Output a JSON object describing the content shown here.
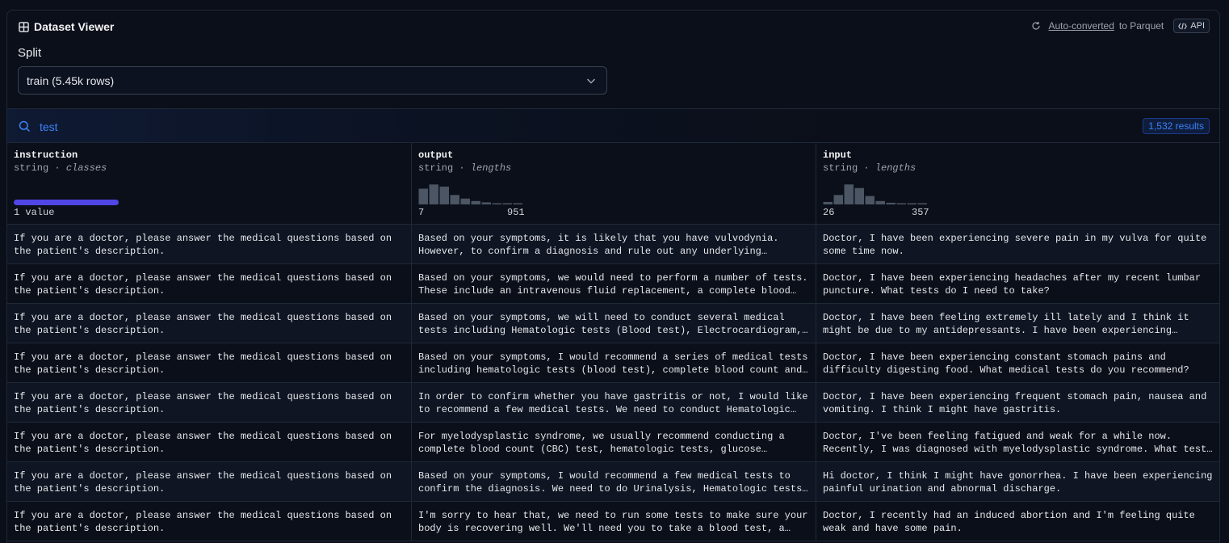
{
  "header": {
    "title": "Dataset Viewer",
    "auto_converted": "Auto-converted",
    "to_parquet": "to Parquet",
    "api": "API"
  },
  "split": {
    "label": "Split",
    "selected": "train (5.45k rows)"
  },
  "search": {
    "value": "test",
    "results": "1,532 results"
  },
  "columns": [
    {
      "name": "instruction",
      "type": "string",
      "kind": "classes",
      "summary": "1 value"
    },
    {
      "name": "output",
      "type": "string",
      "kind": "lengths",
      "min": "7",
      "max": "951",
      "histogram": [
        0.75,
        0.95,
        0.85,
        0.45,
        0.28,
        0.16,
        0.1,
        0.05,
        0.03,
        0.02
      ]
    },
    {
      "name": "input",
      "type": "string",
      "kind": "lengths",
      "min": "26",
      "max": "357",
      "histogram": [
        0.12,
        0.45,
        0.95,
        0.78,
        0.4,
        0.16,
        0.08,
        0.04,
        0.02,
        0.02
      ]
    }
  ],
  "rows": [
    {
      "instruction": "If you are a doctor, please answer the medical questions based on the patient's description.",
      "output": "Based on your symptoms, it is likely that you have vulvodynia. However, to confirm a diagnosis and rule out any underlying conditions, we need to run some tests.",
      "input": "Doctor, I have been experiencing severe pain in my vulva for quite some time now."
    },
    {
      "instruction": "If you are a doctor, please answer the medical questions based on the patient's description.",
      "output": "Based on your symptoms, we would need to perform a number of tests. These include an intravenous fluid replacement, a complete blood count and more.",
      "input": "Doctor, I have been experiencing headaches after my recent lumbar puncture. What tests do I need to take?"
    },
    {
      "instruction": "If you are a doctor, please answer the medical questions based on the patient's description.",
      "output": "Based on your symptoms, we will need to conduct several medical tests including Hematologic tests (Blood test), Electrocardiogram, and more.",
      "input": "Doctor, I have been feeling extremely ill lately and I think it might be due to my antidepressants. I have been experiencing nausea."
    },
    {
      "instruction": "If you are a doctor, please answer the medical questions based on the patient's description.",
      "output": "Based on your symptoms, I would recommend a series of medical tests including hematologic tests (blood test), complete blood count and others.",
      "input": "Doctor, I have been experiencing constant stomach pains and difficulty digesting food. What medical tests do you recommend?"
    },
    {
      "instruction": "If you are a doctor, please answer the medical questions based on the patient's description.",
      "output": "In order to confirm whether you have gastritis or not, I would like to recommend a few medical tests. We need to conduct Hematologic tests.",
      "input": "Doctor, I have been experiencing frequent stomach pain, nausea and vomiting. I think I might have gastritis."
    },
    {
      "instruction": "If you are a doctor, please answer the medical questions based on the patient's description.",
      "output": "For myelodysplastic syndrome, we usually recommend conducting a complete blood count (CBC) test, hematologic tests, glucose measurement and others.",
      "input": "Doctor, I've been feeling fatigued and weak for a while now. Recently, I was diagnosed with myelodysplastic syndrome. What tests do I need?"
    },
    {
      "instruction": "If you are a doctor, please answer the medical questions based on the patient's description.",
      "output": "Based on your symptoms, I would recommend a few medical tests to confirm the diagnosis. We need to do Urinalysis, Hematologic tests and more.",
      "input": "Hi doctor, I think I might have gonorrhea. I have been experiencing painful urination and abnormal discharge."
    },
    {
      "instruction": "If you are a doctor, please answer the medical questions based on the patient's description.",
      "output": "I'm sorry to hear that, we need to run some tests to make sure your body is recovering well. We'll need you to take a blood test, a pelvis exam.",
      "input": "Doctor, I recently had an induced abortion and I'm feeling quite weak and have some pain."
    }
  ]
}
